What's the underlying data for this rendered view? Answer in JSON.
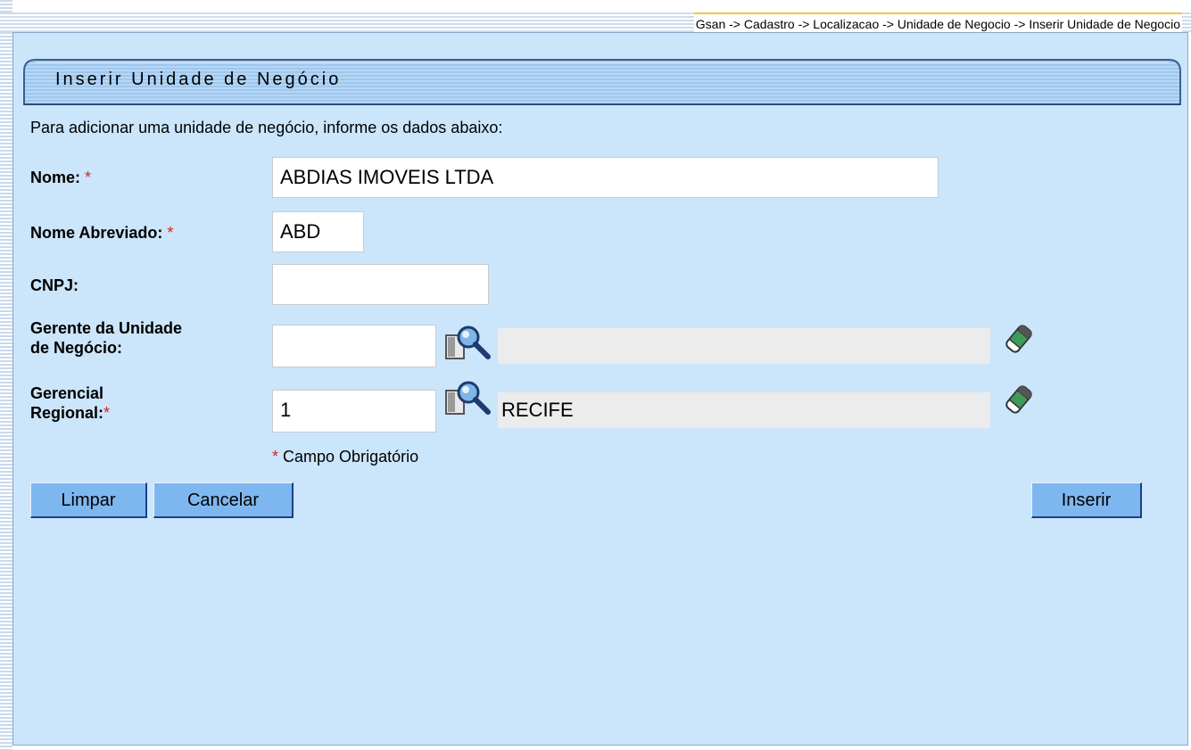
{
  "breadcrumb": "Gsan -> Cadastro -> Localizacao -> Unidade de Negocio -> Inserir Unidade de Negocio",
  "form": {
    "title": "Inserir Unidade de Negócio",
    "intro": "Para adicionar uma unidade de negócio, informe os dados abaixo:",
    "required_mark": "*",
    "fields": {
      "nome": {
        "label": "Nome:",
        "value": "ABDIAS IMOVEIS LTDA"
      },
      "nome_abreviado": {
        "label": "Nome Abreviado:",
        "value": "ABD"
      },
      "cnpj": {
        "label": "CNPJ:",
        "value": ""
      },
      "gerente": {
        "label_line1": "Gerente da Unidade",
        "label_line2": "de Negócio:",
        "code": "",
        "description": ""
      },
      "gerencial": {
        "label_line1": "Gerencial",
        "label_line2": "Regional:",
        "code": "1",
        "description": "RECIFE"
      }
    },
    "required_note": "Campo Obrigatório"
  },
  "buttons": {
    "limpar": "Limpar",
    "cancelar": "Cancelar",
    "inserir": "Inserir"
  },
  "icons": {
    "search": "search-icon",
    "eraser": "eraser-icon"
  },
  "colors": {
    "panel_bg": "#cbe5fb",
    "header_bg": "#a9d0f4",
    "button_bg": "#7eb7f0",
    "required": "#e02020"
  }
}
